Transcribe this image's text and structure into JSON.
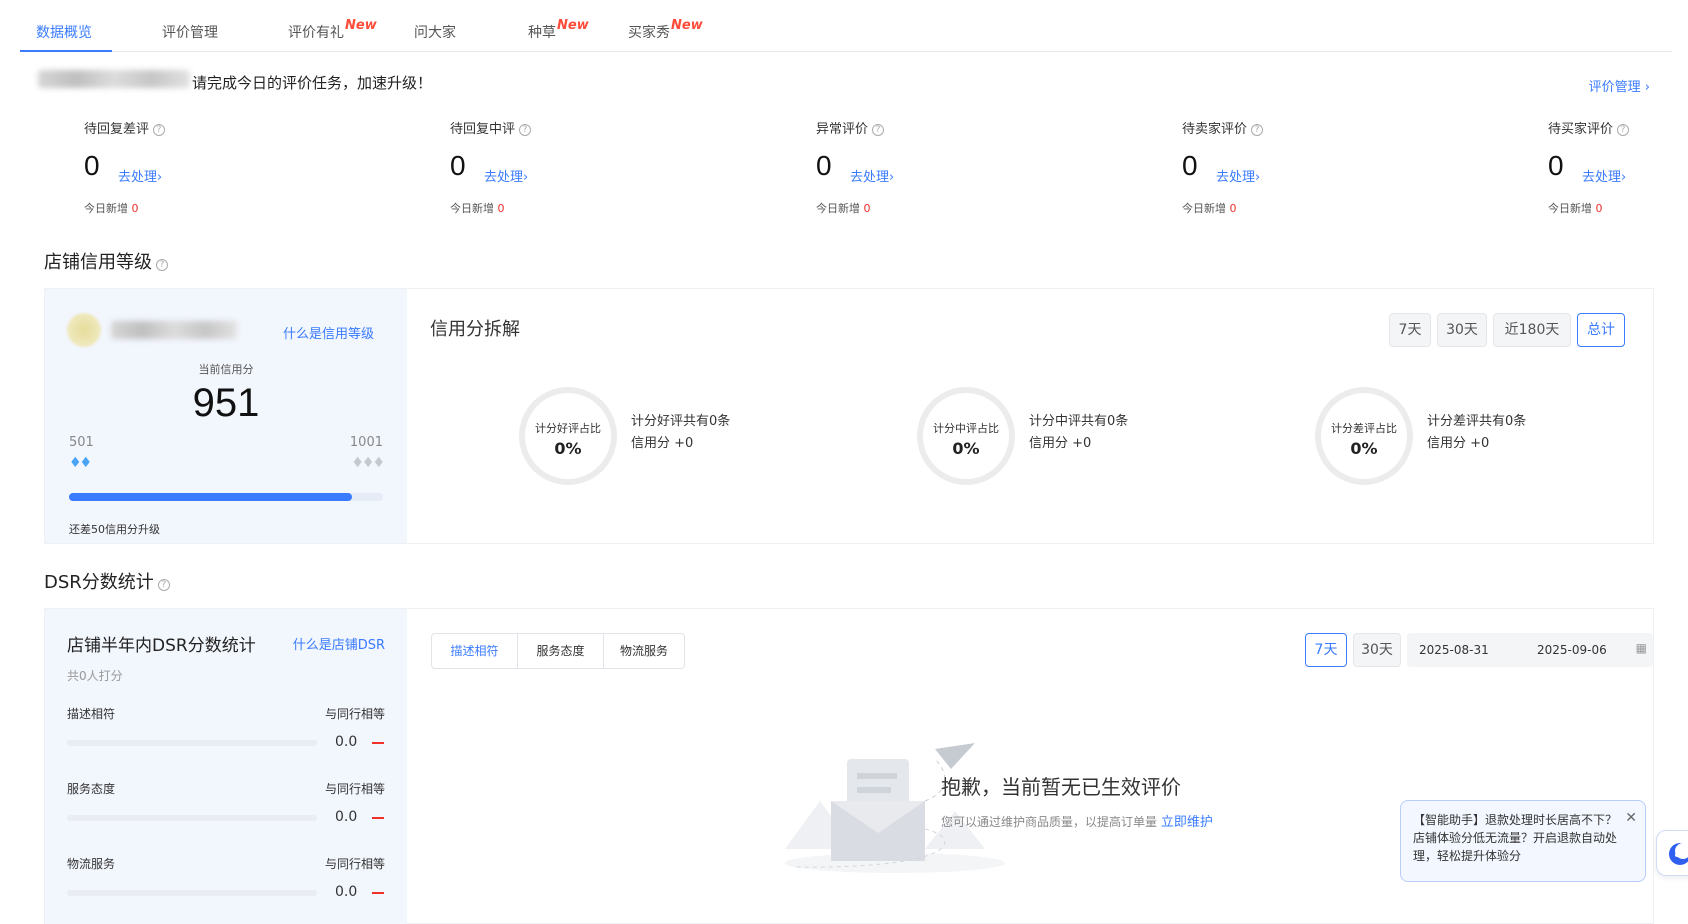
{
  "tabs": [
    {
      "label": "数据概览",
      "new": ""
    },
    {
      "label": "评价管理",
      "new": ""
    },
    {
      "label": "评价有礼",
      "new": "New"
    },
    {
      "label": "问大家",
      "new": ""
    },
    {
      "label": "种草",
      "new": "New"
    },
    {
      "label": "买家秀",
      "new": "New"
    }
  ],
  "banner": {
    "task_text": "请完成今日的评价任务，加速升级！",
    "manage_link": "评价管理 ›"
  },
  "stats": [
    {
      "title": "待回复差评",
      "value": "0",
      "action": "去处理›",
      "new_label": "今日新增",
      "new_value": "0"
    },
    {
      "title": "待回复中评",
      "value": "0",
      "action": "去处理›",
      "new_label": "今日新增",
      "new_value": "0"
    },
    {
      "title": "异常评价",
      "value": "0",
      "action": "去处理›",
      "new_label": "今日新增",
      "new_value": "0"
    },
    {
      "title": "待卖家评价",
      "value": "0",
      "action": "去处理›",
      "new_label": "今日新增",
      "new_value": "0"
    },
    {
      "title": "待买家评价",
      "value": "0",
      "action": "去处理›",
      "new_label": "今日新增",
      "new_value": "0"
    }
  ],
  "credit": {
    "section_title": "店铺信用等级",
    "what_link": "什么是信用等级",
    "current_label": "当前信用分",
    "score": "951",
    "min": "501",
    "max": "1001",
    "progress": 0.9,
    "upgrade_text": "还差50信用分升级",
    "breakdown_title": "信用分拆解",
    "periods": [
      "7天",
      "30天",
      "近180天",
      "总计"
    ],
    "active_period": "总计",
    "rings": [
      {
        "label": "计分好评占比",
        "value": "0%",
        "line1": "计分好评共有0条",
        "line2": "信用分 +0"
      },
      {
        "label": "计分中评占比",
        "value": "0%",
        "line1": "计分中评共有0条",
        "line2": "信用分 +0"
      },
      {
        "label": "计分差评占比",
        "value": "0%",
        "line1": "计分差评共有0条",
        "line2": "信用分 +0"
      }
    ]
  },
  "dsr": {
    "section_title": "DSR分数统计",
    "panel_title": "店铺半年内DSR分数统计",
    "what_link": "什么是店铺DSR",
    "raters": "共0人打分",
    "rows": [
      {
        "label": "描述相符",
        "compare": "与同行相等",
        "value": "0.0"
      },
      {
        "label": "服务态度",
        "compare": "与同行相等",
        "value": "0.0"
      },
      {
        "label": "物流服务",
        "compare": "与同行相等",
        "value": "0.0"
      }
    ],
    "segments": [
      "描述相符",
      "服务态度",
      "物流服务"
    ],
    "periods": [
      "7天",
      "30天"
    ],
    "date_start": "2025-08-31",
    "date_end": "2025-09-06",
    "empty_title": "抱歉，当前暂无已生效评价",
    "empty_sub": "您可以通过维护商品质量，以提高订单量",
    "empty_link": "立即维护"
  },
  "assistant": {
    "tip": "【智能助手】退款处理时长居高不下？店铺体验分低无流量？开启退款自动处理，轻松提升体验分"
  },
  "colors": {
    "accent": "#3a7bff",
    "new_badge": "#ff4d3a",
    "danger": "#f0302a"
  }
}
